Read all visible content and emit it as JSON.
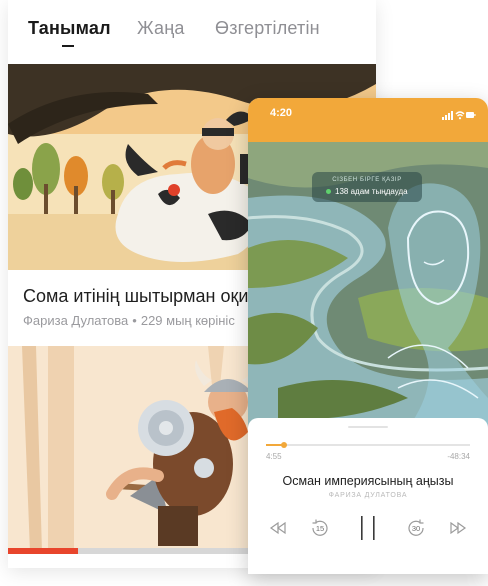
{
  "tabs": [
    {
      "label": "Танымал",
      "active": true
    },
    {
      "label": "Жаңа",
      "active": false
    },
    {
      "label": "Өзгертілетін",
      "active": false
    }
  ],
  "feed": {
    "story": {
      "title": "Сома итінің шытырман оқиғасы",
      "author": "Фариза Дулатова",
      "views": "229 мың көрініс"
    },
    "progress_fraction": 0.19
  },
  "player": {
    "status_time": "4:20",
    "live": {
      "label": "СІЗБЕН БІРГЕ ҚАЗІР",
      "count_text": "138 адам тыңдауда"
    },
    "elapsed": "4:55",
    "remaining": "-48:34",
    "progress_fraction": 0.09,
    "title": "Осман империясының аңызы",
    "author": "ФАРИЗА ДУЛАТОВА",
    "rewind_seconds": "15",
    "forward_seconds": "30"
  },
  "colors": {
    "accent_orange": "#f2a83a",
    "progress_red": "#e8452c",
    "live_green": "#5fd16d"
  },
  "icons": [
    "signal-icon",
    "wifi-icon",
    "battery-icon",
    "previous-icon",
    "rewind-15-icon",
    "pause-icon",
    "forward-30-icon",
    "next-icon"
  ]
}
